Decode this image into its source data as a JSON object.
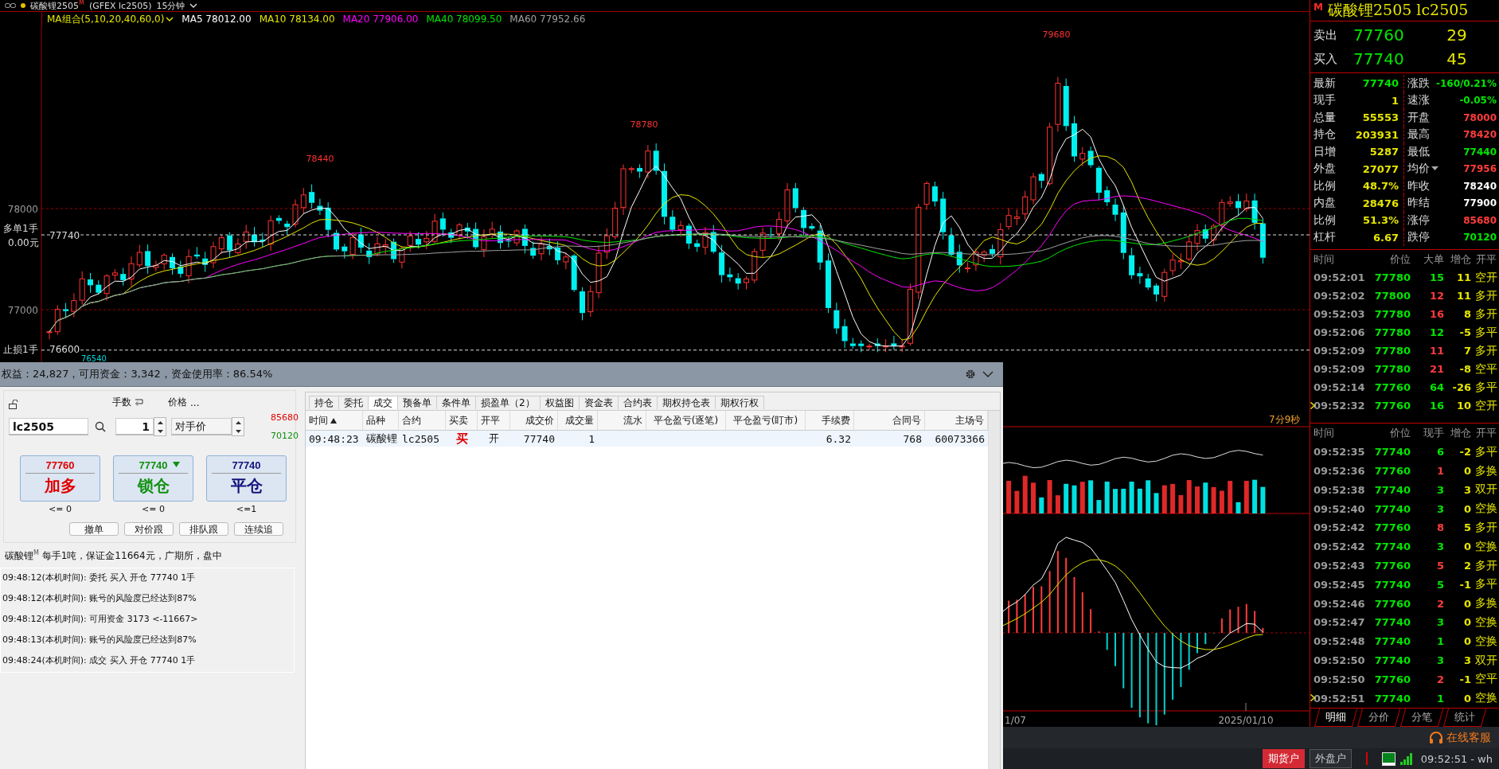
{
  "header": {
    "title": "碳酸锂2505$^{M}$",
    "code": "(GFEX lc2505)",
    "period": "15分钟"
  },
  "ma_legend": {
    "label": "MA组合(5,10,20,40,60,0)",
    "items": [
      {
        "text": "MA5 78012.00",
        "color": "#ffffff"
      },
      {
        "text": "MA10 78134.00",
        "color": "#e6e600"
      },
      {
        "text": "MA20 77906.00",
        "color": "#ff00ff"
      },
      {
        "text": "MA40 78099.50",
        "color": "#00e600"
      },
      {
        "text": "MA60 77952.66",
        "color": "#a0a0a0"
      }
    ]
  },
  "chart": {
    "price_ticks": [
      "78000",
      "77000"
    ],
    "position": {
      "label": "多单1手",
      "pnl": "0.00元",
      "price": "77740"
    },
    "stop": {
      "label": "止损1手",
      "price": "76600"
    },
    "peak_labels": [
      "78440",
      "78780",
      "79680"
    ],
    "low_label": "76540",
    "countdown": "7分9秒",
    "date_labels": [
      "1/07",
      "2025/01/10"
    ]
  },
  "quote": {
    "badge": "M",
    "name": "碳酸锂2505",
    "code": "lc2505",
    "book": [
      {
        "label": "卖出",
        "price": "77760",
        "volume": "29"
      },
      {
        "label": "买入",
        "price": "77740",
        "volume": "45"
      }
    ],
    "stats": [
      {
        "label": "最新",
        "value": "77740",
        "color": "#00e600",
        "menu": false
      },
      {
        "label": "涨跌",
        "value": "-160/0.21%",
        "color": "#00e600",
        "menu": false
      },
      {
        "label": "现手",
        "value": "1",
        "color": "#e6e600",
        "menu": false
      },
      {
        "label": "速涨",
        "value": "-0.05%",
        "color": "#00e600",
        "menu": false
      },
      {
        "label": "总量",
        "value": "55553",
        "color": "#e6e600",
        "menu": false
      },
      {
        "label": "开盘",
        "value": "78000",
        "color": "#ff3c3c",
        "menu": false
      },
      {
        "label": "持仓",
        "value": "203931",
        "color": "#e6e600",
        "menu": false
      },
      {
        "label": "最高",
        "value": "78420",
        "color": "#ff3c3c",
        "menu": false
      },
      {
        "label": "日增",
        "value": "5287",
        "color": "#e6e600",
        "menu": false
      },
      {
        "label": "最低",
        "value": "77440",
        "color": "#00e600",
        "menu": false
      },
      {
        "label": "外盘",
        "value": "27077",
        "color": "#e6e600",
        "menu": false
      },
      {
        "label": "均价",
        "value": "77956",
        "color": "#ff3c3c",
        "menu": true
      },
      {
        "label": "比例",
        "value": "48.7%",
        "color": "#e6e600",
        "menu": false
      },
      {
        "label": "昨收",
        "value": "78240",
        "color": "#ffffff",
        "menu": false
      },
      {
        "label": "内盘",
        "value": "28476",
        "color": "#e6e600",
        "menu": false
      },
      {
        "label": "昨结",
        "value": "77900",
        "color": "#ffffff",
        "menu": false
      },
      {
        "label": "比例",
        "value": "51.3%",
        "color": "#e6e600",
        "menu": false
      },
      {
        "label": "涨停",
        "value": "85680",
        "color": "#ff3c3c",
        "menu": false
      },
      {
        "label": "杠杆",
        "value": "6.67",
        "color": "#e6e600",
        "menu": false
      },
      {
        "label": "跌停",
        "value": "70120",
        "color": "#00e600",
        "menu": false
      }
    ],
    "ticks_top": {
      "columns": [
        "时间",
        "价位",
        "大单",
        "增仓",
        "开平"
      ],
      "rows": [
        {
          "time": "09:52:01",
          "price": "77780",
          "volume": "15",
          "color": "#00e600",
          "change": "11",
          "type": "空开",
          "current": false
        },
        {
          "time": "09:52:02",
          "price": "77800",
          "volume": "12",
          "color": "#ff3c3c",
          "change": "11",
          "type": "多开",
          "current": false
        },
        {
          "time": "09:52:03",
          "price": "77780",
          "volume": "16",
          "color": "#ff3c3c",
          "change": "8",
          "type": "多开",
          "current": false
        },
        {
          "time": "09:52:06",
          "price": "77780",
          "volume": "12",
          "color": "#00e600",
          "change": "-5",
          "type": "多平",
          "current": false
        },
        {
          "time": "09:52:09",
          "price": "77780",
          "volume": "11",
          "color": "#ff3c3c",
          "change": "7",
          "type": "多开",
          "current": false
        },
        {
          "time": "09:52:09",
          "price": "77780",
          "volume": "21",
          "color": "#ff3c3c",
          "change": "-8",
          "type": "空平",
          "current": false
        },
        {
          "time": "09:52:14",
          "price": "77760",
          "volume": "64",
          "color": "#00e600",
          "change": "-26",
          "type": "多平",
          "current": false
        },
        {
          "time": "09:52:32",
          "price": "77760",
          "volume": "16",
          "color": "#00e600",
          "change": "10",
          "type": "空开",
          "current": true
        }
      ]
    },
    "ticks_bottom": {
      "columns": [
        "时间",
        "价位",
        "现手",
        "增仓",
        "开平"
      ],
      "rows": [
        {
          "time": "09:52:35",
          "price": "77740",
          "volume": "6",
          "color": "#00e600",
          "change": "-2",
          "type": "多平",
          "current": false
        },
        {
          "time": "09:52:36",
          "price": "77760",
          "volume": "1",
          "color": "#ff3c3c",
          "change": "0",
          "type": "多换",
          "current": false
        },
        {
          "time": "09:52:38",
          "price": "77740",
          "volume": "3",
          "color": "#00e600",
          "change": "3",
          "type": "双开",
          "current": false
        },
        {
          "time": "09:52:40",
          "price": "77740",
          "volume": "3",
          "color": "#00e600",
          "change": "0",
          "type": "空换",
          "current": false
        },
        {
          "time": "09:52:42",
          "price": "77760",
          "volume": "8",
          "color": "#ff3c3c",
          "change": "5",
          "type": "多开",
          "current": false
        },
        {
          "time": "09:52:42",
          "price": "77740",
          "volume": "3",
          "color": "#00e600",
          "change": "0",
          "type": "空换",
          "current": false
        },
        {
          "time": "09:52:43",
          "price": "77760",
          "volume": "5",
          "color": "#ff3c3c",
          "change": "2",
          "type": "多开",
          "current": false
        },
        {
          "time": "09:52:45",
          "price": "77740",
          "volume": "5",
          "color": "#00e600",
          "change": "-1",
          "type": "多平",
          "current": false
        },
        {
          "time": "09:52:46",
          "price": "77760",
          "volume": "2",
          "color": "#ff3c3c",
          "change": "0",
          "type": "多换",
          "current": false
        },
        {
          "time": "09:52:47",
          "price": "77740",
          "volume": "3",
          "color": "#00e600",
          "change": "0",
          "type": "空换",
          "current": false
        },
        {
          "time": "09:52:48",
          "price": "77740",
          "volume": "1",
          "color": "#00e600",
          "change": "0",
          "type": "空换",
          "current": false
        },
        {
          "time": "09:52:50",
          "price": "77740",
          "volume": "3",
          "color": "#00e600",
          "change": "3",
          "type": "双开",
          "current": false
        },
        {
          "time": "09:52:50",
          "price": "77760",
          "volume": "2",
          "color": "#ff3c3c",
          "change": "-1",
          "type": "空平",
          "current": false
        },
        {
          "time": "09:52:51",
          "price": "77740",
          "volume": "1",
          "color": "#00e600",
          "change": "0",
          "type": "空换",
          "current": true
        }
      ]
    },
    "tabs": [
      {
        "label": "明细",
        "selected": true
      },
      {
        "label": "分价",
        "selected": false
      },
      {
        "label": "分笔",
        "selected": false
      },
      {
        "label": "统计",
        "selected": false
      }
    ]
  },
  "service": {
    "label": "在线客服"
  },
  "status_bar": {
    "accounts": [
      {
        "label": "期货户",
        "selected": true
      },
      {
        "label": "外盘户",
        "selected": false
      }
    ],
    "time": "09:52:51 - wh"
  },
  "trade_window": {
    "title": "权益：24,827，可用资金：3,342，资金使用率：86.54%",
    "order": {
      "code": "lc2505",
      "qty_label": "手数",
      "qty": "1",
      "price_label": "价格",
      "price_more": "...",
      "price_type": "对手价",
      "limit_up": "85680",
      "limit_down": "70120",
      "actions": [
        {
          "price": "77760",
          "label": "加多",
          "limit": "<= 0",
          "color": "#e00000",
          "menu": false
        },
        {
          "price": "77740",
          "label": "锁仓",
          "limit": "<= 0",
          "color": "#119011",
          "menu": true
        },
        {
          "price": "77740",
          "label": "平仓",
          "limit": "<=1",
          "color": "#12127a",
          "menu": false
        }
      ],
      "buttons": [
        "撤单",
        "对价跟",
        "排队跟",
        "连续追"
      ]
    },
    "info": "碳酸锂$^{M}$ 每手1吨，保证金11664元，广期所，盘中",
    "log": [
      "09:48:12(本机时间): 委托  买入  开仓  77740  1手",
      "09:48:12(本机时间): 账号的风险度已经达到87%",
      "09:48:12(本机时间): 可用资金 3173  <-11667>",
      "09:48:13(本机时间): 账号的风险度已经达到87%",
      "09:48:24(本机时间): 成交  买入  开仓  77740  1手"
    ],
    "tabs": [
      {
        "label": "持仓",
        "selected": false
      },
      {
        "label": "委托",
        "selected": false
      },
      {
        "label": "成交",
        "selected": true
      },
      {
        "label": "预备单",
        "selected": false
      },
      {
        "label": "条件单",
        "selected": false
      },
      {
        "label": "损盈单（2）",
        "selected": false
      },
      {
        "label": "权益图",
        "selected": false
      },
      {
        "label": "资金表",
        "selected": false
      },
      {
        "label": "合约表",
        "selected": false
      },
      {
        "label": "期权持仓表",
        "selected": false
      },
      {
        "label": "期权行权",
        "selected": false
      }
    ],
    "table": {
      "columns": [
        {
          "label": "时间",
          "sorted": true
        },
        {
          "label": "品种",
          "sorted": false
        },
        {
          "label": "合约",
          "sorted": false
        },
        {
          "label": "买卖",
          "sorted": false
        },
        {
          "label": "开平",
          "sorted": false
        },
        {
          "label": "成交价",
          "sorted": false
        },
        {
          "label": "成交量",
          "sorted": false
        },
        {
          "label": "流水",
          "sorted": false
        },
        {
          "label": "平仓盈亏(逐笔)",
          "sorted": false
        },
        {
          "label": "平仓盈亏(盯市)",
          "sorted": false
        },
        {
          "label": "手续费",
          "sorted": false
        },
        {
          "label": "合同号",
          "sorted": false
        },
        {
          "label": "主场号",
          "sorted": false
        }
      ],
      "rows": [
        {
          "color": "#e00000",
          "cells": [
            "09:48:23",
            "碳酸锂",
            "lc2505",
            "买",
            "开",
            "77740",
            "1",
            null,
            null,
            null,
            "6.32",
            "768",
            "60073366"
          ]
        }
      ]
    }
  }
}
